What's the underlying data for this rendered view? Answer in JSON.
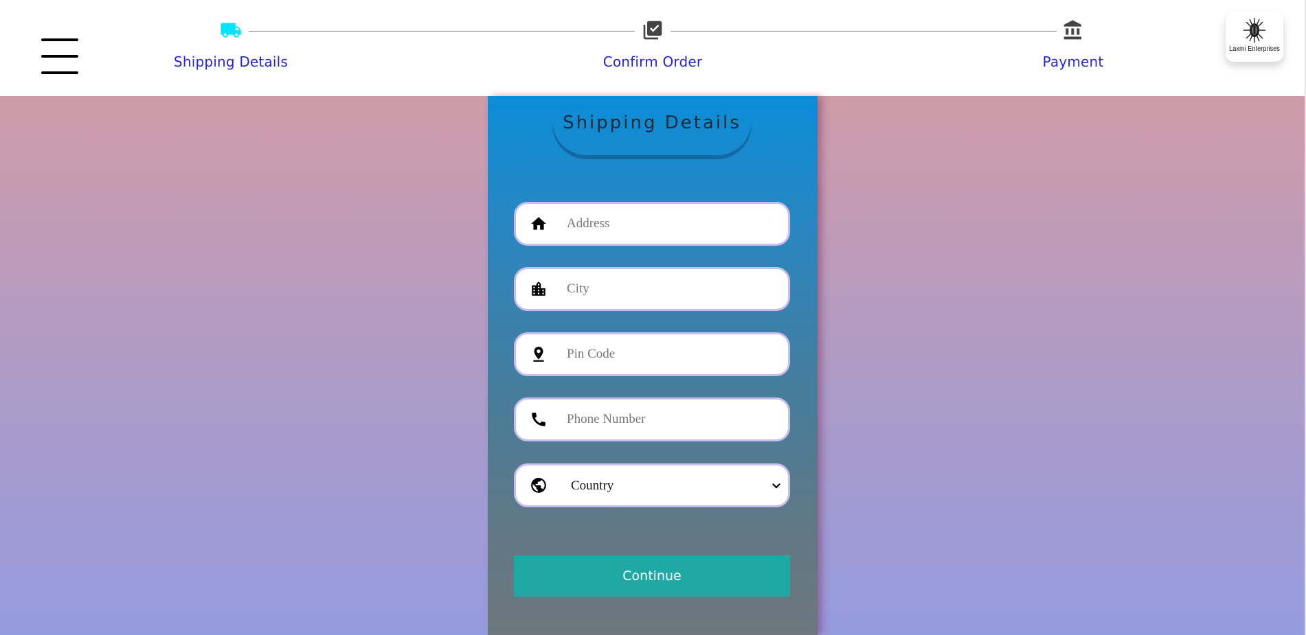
{
  "header": {
    "menu_icon": "hamburger-menu-icon",
    "steps": [
      {
        "label": "Shipping Details",
        "icon": "truck-icon",
        "color": "#00e5ff",
        "active": true
      },
      {
        "label": "Confirm Order",
        "icon": "library-add-check-icon",
        "color": "#444444",
        "active": false
      },
      {
        "label": "Payment",
        "icon": "bank-icon",
        "color": "#444444",
        "active": false
      }
    ],
    "logo": {
      "text": "Laxmi Enterprises",
      "icon": "logo-emblem-icon"
    }
  },
  "card": {
    "title": "Shipping Details",
    "fields": [
      {
        "icon": "home-icon",
        "placeholder": "Address",
        "value": ""
      },
      {
        "icon": "city-icon",
        "placeholder": "City",
        "value": ""
      },
      {
        "icon": "pin-icon",
        "placeholder": "Pin Code",
        "value": ""
      },
      {
        "icon": "phone-icon",
        "placeholder": "Phone Number",
        "value": ""
      }
    ],
    "country": {
      "icon": "globe-icon",
      "selected": "Country"
    },
    "continue_label": "Continue"
  },
  "colors": {
    "step_label": "#2424d4",
    "active_step_icon": "#00e5ff",
    "button": "#1fa9a5",
    "field_border": "#c9bdf0"
  }
}
